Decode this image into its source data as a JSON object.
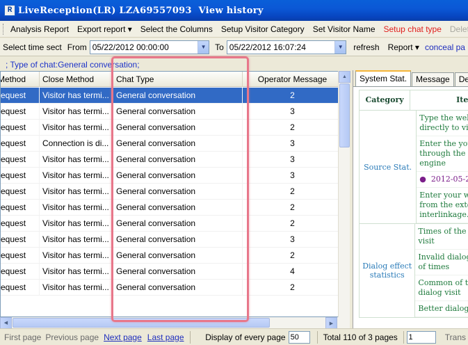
{
  "window": {
    "icon_text": "R",
    "title": "LiveReception(LR) LZA69557093  View history"
  },
  "menu": {
    "items": [
      {
        "label": "Analysis Report",
        "style": "normal"
      },
      {
        "label": "Export report ▾",
        "style": "normal"
      },
      {
        "label": "Select the Columns",
        "style": "normal"
      },
      {
        "label": "Setup Visitor Category",
        "style": "normal"
      },
      {
        "label": "Set Visitor Name",
        "style": "normal"
      },
      {
        "label": "Setup chat type",
        "style": "red"
      },
      {
        "label": "Delete",
        "style": "disabled"
      }
    ]
  },
  "filter": {
    "select_time_label": "Select time sect",
    "from_label": "From",
    "from_value": "05/22/2012 00:00:00",
    "to_label": "To",
    "to_value": "05/22/2012 16:07:24",
    "refresh_label": "refresh",
    "report_label": "Report ▾",
    "conceal_label": "conceal pa"
  },
  "filter_hint": ";  Type of chat:General conversation;",
  "grid": {
    "columns": [
      "Method",
      "Close Method",
      "Chat Type",
      "Operator Message"
    ],
    "rows": [
      [
        "request",
        "Visitor has termi...",
        "General conversation",
        "2"
      ],
      [
        "request",
        "Visitor has termi...",
        "General conversation",
        "3"
      ],
      [
        "request",
        "Visitor has termi...",
        "General conversation",
        "2"
      ],
      [
        "request",
        "Connection is di...",
        "General conversation",
        "3"
      ],
      [
        "request",
        "Visitor has termi...",
        "General conversation",
        "3"
      ],
      [
        "request",
        "Visitor has termi...",
        "General conversation",
        "3"
      ],
      [
        "request",
        "Visitor has termi...",
        "General conversation",
        "2"
      ],
      [
        "request",
        "Visitor has termi...",
        "General conversation",
        "2"
      ],
      [
        "request",
        "Visitor has termi...",
        "General conversation",
        "2"
      ],
      [
        "request",
        "Visitor has termi...",
        "General conversation",
        "3"
      ],
      [
        "request",
        "Visitor has termi...",
        "General conversation",
        "2"
      ],
      [
        "request",
        "Visitor has termi...",
        "General conversation",
        "4"
      ],
      [
        "request",
        "Visitor has termi...",
        "General conversation",
        "2"
      ]
    ],
    "selected_row": 0
  },
  "right_panel": {
    "tabs": [
      "System Stat.",
      "Message",
      "Deta"
    ],
    "active_tab": 0,
    "header": {
      "category": "Category",
      "item": "Item"
    },
    "sections": [
      {
        "category": "Source Stat.",
        "items": [
          "Type the web\ndirectly to visi",
          "Enter the your\nthrough the se\nengine",
          "●  2012-05-2",
          "Enter your we\nfrom the exter\ninterlinkage."
        ]
      },
      {
        "category": "Dialog effect\nstatistics",
        "items": [
          "Times of the n\nvisit",
          "Invalid dialog\nof times",
          "Common of th\ndialog visit",
          "Better dialog n"
        ]
      }
    ]
  },
  "status": {
    "first_page": "First page",
    "previous_page": "Previous page",
    "next_page": "Next page",
    "last_page": "Last page",
    "display_label": "Display of every page",
    "per_page": "50",
    "total_label": "Total 110 of 3 pages",
    "page_input": "1",
    "trans_label": "Trans"
  },
  "colors": {
    "title_bar": "#0a5fd8",
    "selection": "#316ac5",
    "highlight_box": "#e8778a",
    "link": "#1e2dbd",
    "warn_menu": "#e0201e"
  }
}
